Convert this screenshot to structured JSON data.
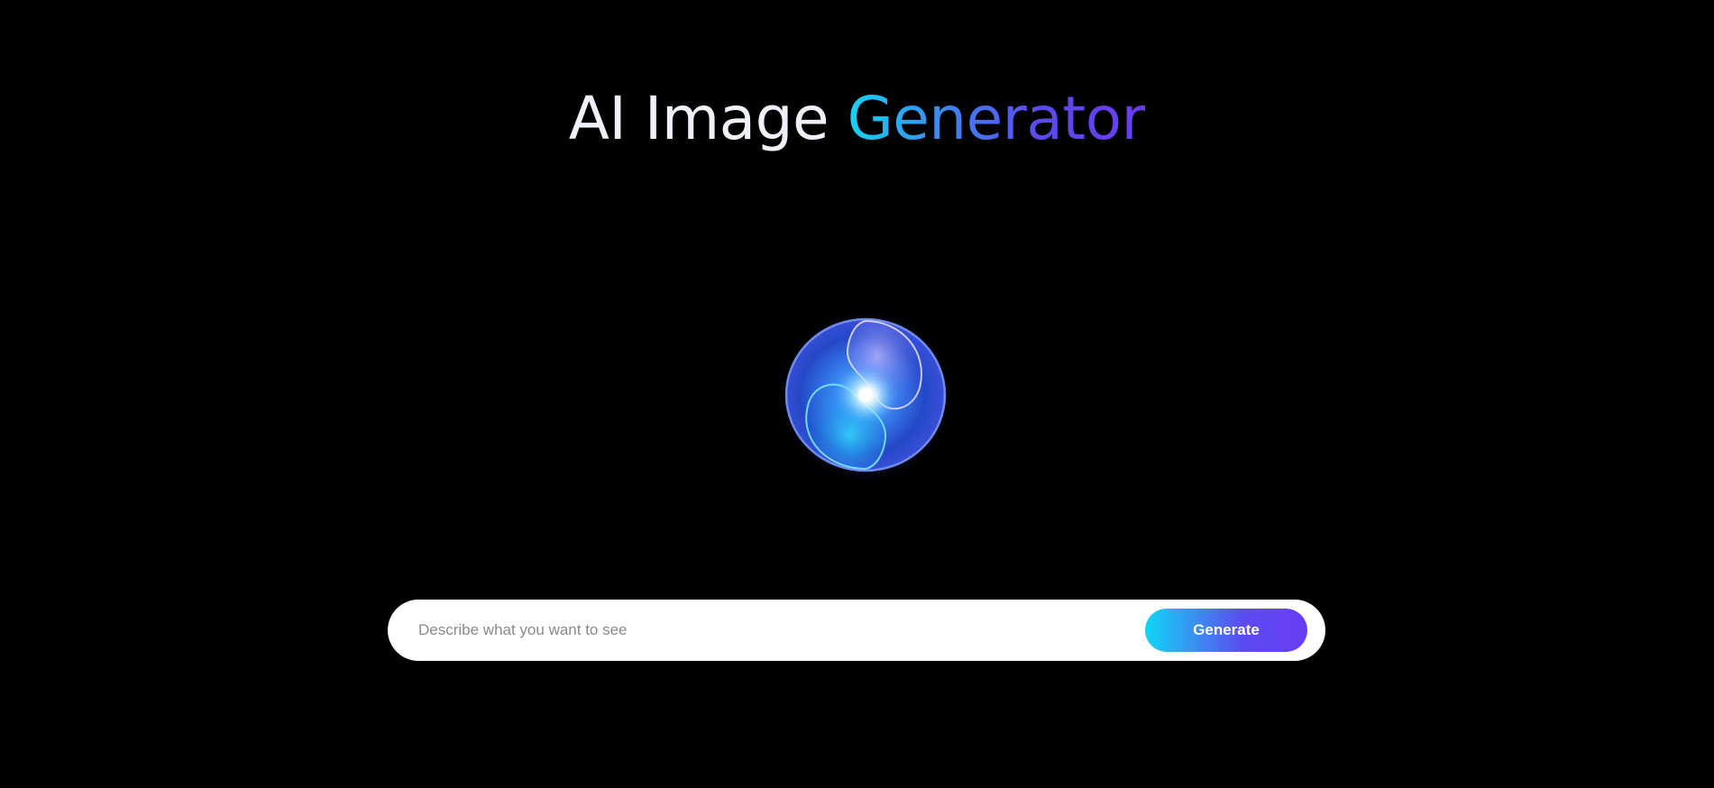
{
  "header": {
    "title_plain": "AI Image ",
    "title_accent": "Generator"
  },
  "orb": {
    "icon": "glowing-orb-icon"
  },
  "prompt": {
    "placeholder": "Describe what you want to see",
    "value": ""
  },
  "actions": {
    "generate_label": "Generate"
  },
  "colors": {
    "background": "#000000",
    "accent_start": "#10d6f8",
    "accent_end": "#6a3cf4"
  }
}
